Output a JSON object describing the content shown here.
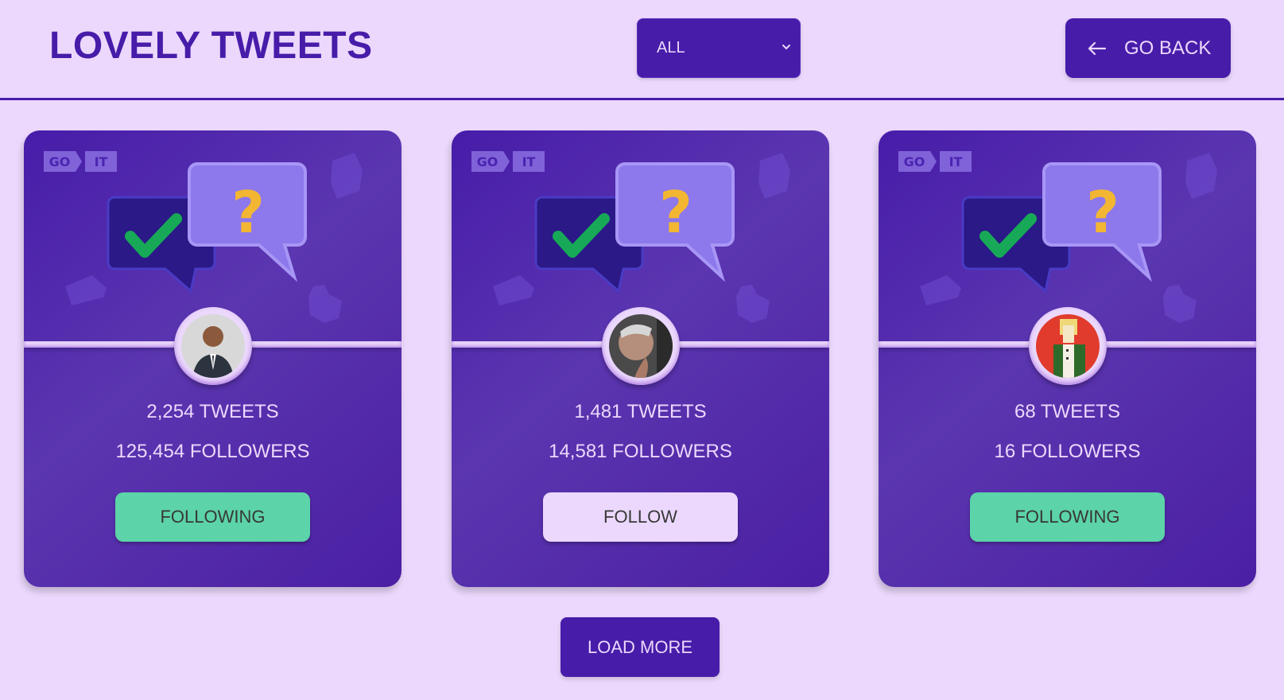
{
  "header": {
    "title": "LOVELY TWEETS",
    "filter_value": "ALL",
    "go_back_label": "GO BACK"
  },
  "cards": [
    {
      "logo_text": "GO IT",
      "tweets": "2,254 TWEETS",
      "followers": "125,454 FOLLOWERS",
      "button_label": "FOLLOWING",
      "button_state": "following"
    },
    {
      "logo_text": "GO IT",
      "tweets": "1,481 TWEETS",
      "followers": "14,581 FOLLOWERS",
      "button_label": "FOLLOW",
      "button_state": "follow"
    },
    {
      "logo_text": "GO IT",
      "tweets": "68 TWEETS",
      "followers": "16 FOLLOWERS",
      "button_label": "FOLLOWING",
      "button_state": "following"
    }
  ],
  "load_more_label": "LOAD MORE",
  "colors": {
    "background": "#ebd8fc",
    "primary": "#471ca9",
    "following": "#5cd3a8",
    "text_light": "#ebd8fc",
    "text_dark": "#373737"
  }
}
